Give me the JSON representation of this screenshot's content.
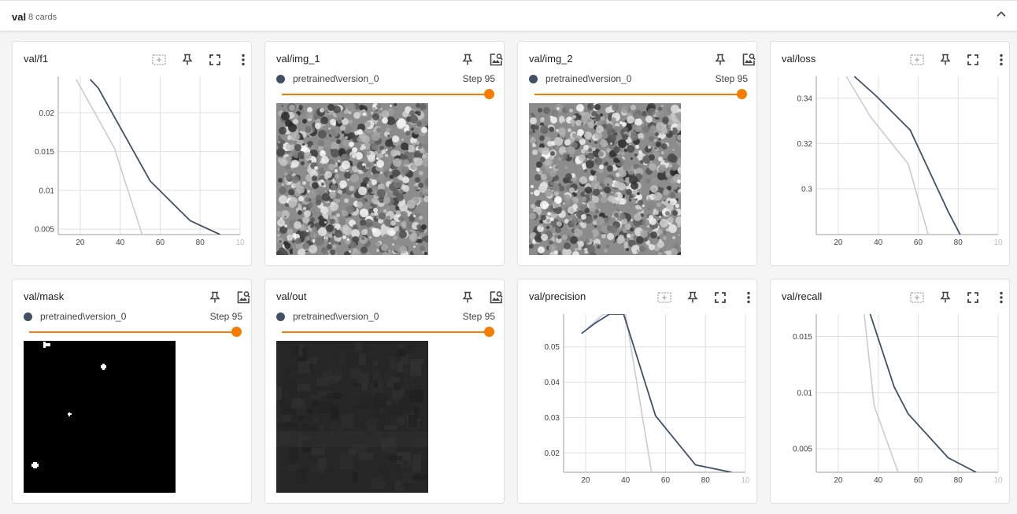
{
  "group": {
    "title": "val",
    "count_label": "8 cards"
  },
  "colors": {
    "series_main": "#425066",
    "series_faded": "#c9cbd6",
    "accent": "#f57c00",
    "grid": "#e0e0e0"
  },
  "cards": [
    {
      "id": "f1",
      "title": "val/f1",
      "kind": "scalar",
      "icons": [
        "fit-domain-icon",
        "pin-icon",
        "fullscreen-icon",
        "more-vert-icon"
      ],
      "chart_data": {
        "type": "line",
        "x_ticks": [
          "20",
          "40",
          "60",
          "80",
          "10"
        ],
        "y_ticks": [
          "0.02",
          "0.015",
          "0.01",
          "0.005"
        ],
        "xlim": [
          9,
          100
        ],
        "ylim": [
          0.0043,
          0.0247
        ],
        "series": [
          {
            "values": [
              [
                25,
                0.0243
              ],
              [
                29,
                0.0232
              ],
              [
                55,
                0.0112
              ],
              [
                75,
                0.0061
              ],
              [
                90,
                0.0043
              ]
            ]
          },
          {
            "values": [
              [
                18,
                0.0243
              ],
              [
                37,
                0.0155
              ],
              [
                51,
                0.0043
              ]
            ]
          }
        ]
      }
    },
    {
      "id": "img_1",
      "title": "val/img_1",
      "kind": "image",
      "icons": [
        "pin-icon",
        "image-search-icon"
      ],
      "run": "pretrained\\version_0",
      "step": "Step 95",
      "step_value": 95,
      "image_style": "noisy-texture",
      "seed": 11
    },
    {
      "id": "img_2",
      "title": "val/img_2",
      "kind": "image",
      "icons": [
        "pin-icon",
        "image-search-icon"
      ],
      "run": "pretrained\\version_0",
      "step": "Step 95",
      "step_value": 95,
      "image_style": "noisy-texture",
      "seed": 23
    },
    {
      "id": "loss",
      "title": "val/loss",
      "kind": "scalar",
      "icons": [
        "fit-domain-icon",
        "pin-icon",
        "fullscreen-icon",
        "more-vert-icon"
      ],
      "chart_data": {
        "type": "line",
        "x_ticks": [
          "20",
          "40",
          "60",
          "80",
          "10"
        ],
        "y_ticks": [
          "0.34",
          "0.32",
          "0.3"
        ],
        "xlim": [
          9,
          100
        ],
        "ylim": [
          0.2798,
          0.3497
        ],
        "series": [
          {
            "values": [
              [
                28,
                0.3497
              ],
              [
                39,
                0.341
              ],
              [
                56,
                0.326
              ],
              [
                75,
                0.29
              ],
              [
                81,
                0.2798
              ]
            ]
          },
          {
            "values": [
              [
                24,
                0.3497
              ],
              [
                36,
                0.332
              ],
              [
                55,
                0.311
              ],
              [
                65,
                0.2798
              ]
            ]
          }
        ]
      }
    },
    {
      "id": "mask",
      "title": "val/mask",
      "kind": "image",
      "icons": [
        "pin-icon",
        "image-search-icon"
      ],
      "run": "pretrained\\version_0",
      "step": "Step 95",
      "step_value": 95,
      "image_style": "mask"
    },
    {
      "id": "out",
      "title": "val/out",
      "kind": "image",
      "icons": [
        "pin-icon",
        "image-search-icon"
      ],
      "run": "pretrained\\version_0",
      "step": "Step 95",
      "step_value": 95,
      "image_style": "dark-output",
      "seed": 37
    },
    {
      "id": "precision",
      "title": "val/precision",
      "kind": "scalar",
      "icons": [
        "fit-domain-icon",
        "pin-icon",
        "fullscreen-icon",
        "more-vert-icon"
      ],
      "chart_data": {
        "type": "line",
        "x_ticks": [
          "20",
          "40",
          "60",
          "80",
          "10"
        ],
        "y_ticks": [
          "0.05",
          "0.04",
          "0.03",
          "0.02"
        ],
        "xlim": [
          9,
          100
        ],
        "ylim": [
          0.0145,
          0.0593
        ],
        "series": [
          {
            "values": [
              [
                18,
                0.0538
              ],
              [
                25,
                0.0568
              ],
              [
                32,
                0.0593
              ],
              [
                39,
                0.0593
              ],
              [
                55,
                0.0305
              ],
              [
                75,
                0.0166
              ],
              [
                93,
                0.0145
              ]
            ]
          },
          {
            "values": [
              [
                21,
                0.0553
              ],
              [
                29,
                0.0593
              ],
              [
                40,
                0.0593
              ],
              [
                53,
                0.0145
              ]
            ]
          }
        ]
      }
    },
    {
      "id": "recall",
      "title": "val/recall",
      "kind": "scalar",
      "icons": [
        "fit-domain-icon",
        "pin-icon",
        "fullscreen-icon",
        "more-vert-icon"
      ],
      "chart_data": {
        "type": "line",
        "x_ticks": [
          "20",
          "40",
          "60",
          "80",
          "10"
        ],
        "y_ticks": [
          "0.015",
          "0.01",
          "0.005"
        ],
        "xlim": [
          9,
          100
        ],
        "ylim": [
          0.0029,
          0.017
        ],
        "series": [
          {
            "values": [
              [
                36,
                0.017
              ],
              [
                48,
                0.0105
              ],
              [
                55,
                0.0081
              ],
              [
                75,
                0.0042
              ],
              [
                89,
                0.0029
              ]
            ]
          },
          {
            "values": [
              [
                33,
                0.017
              ],
              [
                38,
                0.0088
              ],
              [
                50,
                0.0029
              ]
            ]
          }
        ]
      }
    }
  ]
}
